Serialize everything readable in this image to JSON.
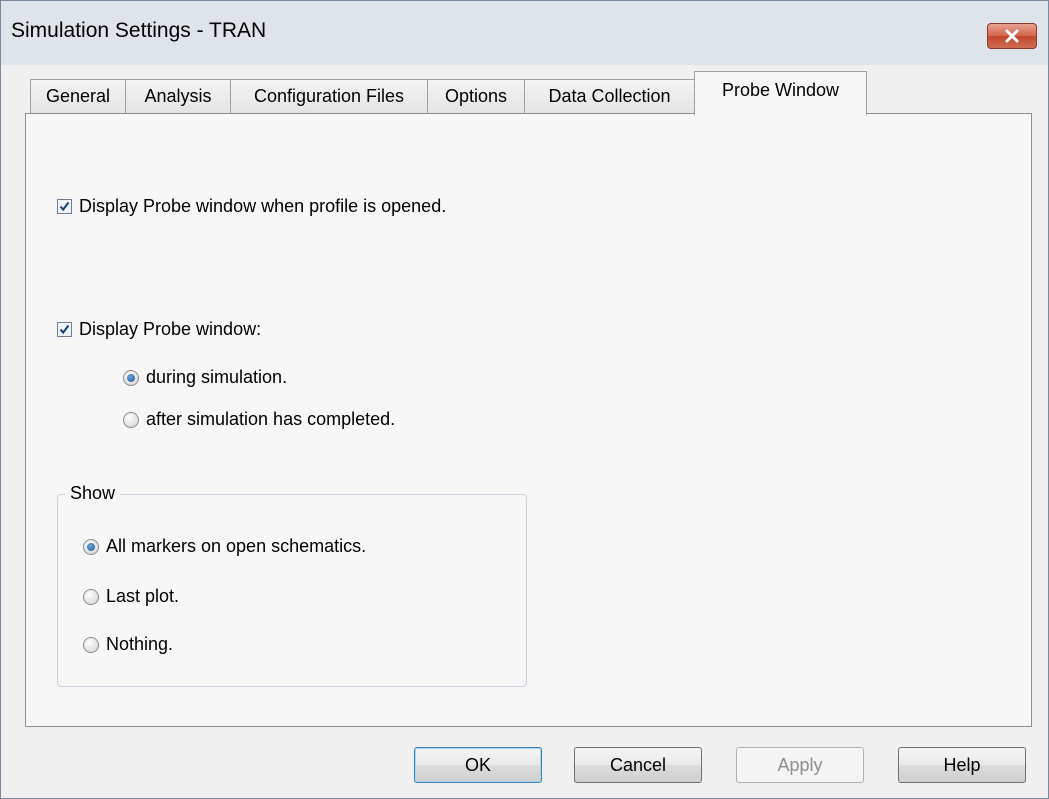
{
  "window": {
    "title": "Simulation Settings - TRAN"
  },
  "tabs": [
    {
      "label": "General"
    },
    {
      "label": "Analysis"
    },
    {
      "label": "Configuration Files"
    },
    {
      "label": "Options"
    },
    {
      "label": "Data Collection"
    },
    {
      "label": "Probe Window",
      "active": true
    }
  ],
  "probe": {
    "display_on_open": {
      "label": "Display Probe window when profile is opened.",
      "checked": true
    },
    "display_window": {
      "label": "Display Probe window:",
      "checked": true
    },
    "timing": [
      {
        "label": "during simulation.",
        "selected": true
      },
      {
        "label": "after simulation has completed.",
        "selected": false
      }
    ],
    "show": {
      "title": "Show",
      "options": [
        {
          "label": "All markers on open schematics.",
          "selected": true
        },
        {
          "label": "Last plot.",
          "selected": false
        },
        {
          "label": "Nothing.",
          "selected": false
        }
      ]
    }
  },
  "buttons": {
    "ok": "OK",
    "cancel": "Cancel",
    "apply": "Apply",
    "help": "Help"
  },
  "colors": {
    "close_button": "#c84a32",
    "accent": "#3c7fb1"
  },
  "icons": {
    "close": "close-icon",
    "check": "checkmark-icon",
    "radio": "radio-dot-icon"
  }
}
